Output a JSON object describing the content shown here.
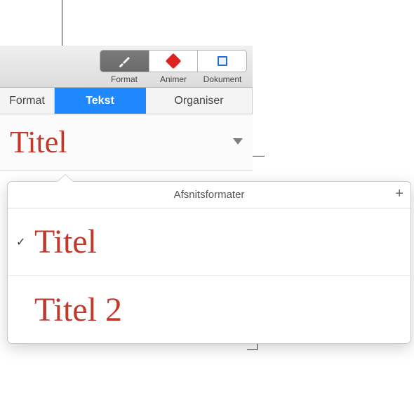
{
  "toolbar": {
    "items": [
      {
        "label": "Format",
        "icon": "brush-icon",
        "active": true
      },
      {
        "label": "Animer",
        "icon": "diamond-icon",
        "active": false
      },
      {
        "label": "Dokument",
        "icon": "document-icon",
        "active": false
      }
    ]
  },
  "sub_tabs": {
    "items": [
      {
        "label": "Format",
        "active": false
      },
      {
        "label": "Tekst",
        "active": true
      },
      {
        "label": "Organiser",
        "active": false
      }
    ]
  },
  "current_style": {
    "label": "Titel"
  },
  "popover": {
    "heading": "Afsnitsformater",
    "add_label": "+",
    "items": [
      {
        "label": "Titel",
        "selected": true
      },
      {
        "label": "Titel 2",
        "selected": false
      }
    ]
  },
  "glyphs": {
    "check": "✓"
  },
  "colors": {
    "accent_red": "#c0392b",
    "tab_blue": "#1f88ff"
  }
}
